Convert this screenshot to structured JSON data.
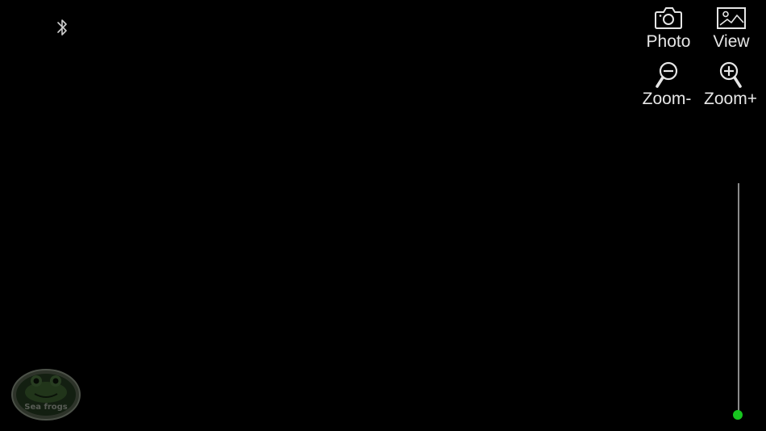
{
  "status": {
    "bluetooth_icon": "bluetooth-icon"
  },
  "toolbar": {
    "photo_label": "Photo",
    "photo_icon": "camera-icon",
    "view_label": "View",
    "view_icon": "image-icon",
    "zoom_out_label": "Zoom-",
    "zoom_out_icon": "zoom-out-icon",
    "zoom_in_label": "Zoom+",
    "zoom_in_icon": "zoom-in-icon"
  },
  "zoom_slider": {
    "level": 0.0,
    "thumb_color": "#17c51f",
    "track_color": "#8a8a8a"
  },
  "logo": {
    "text": "Sea frogs",
    "icon": "frog-logo"
  },
  "colors": {
    "background": "#000000",
    "label": "#e6e6e6"
  }
}
